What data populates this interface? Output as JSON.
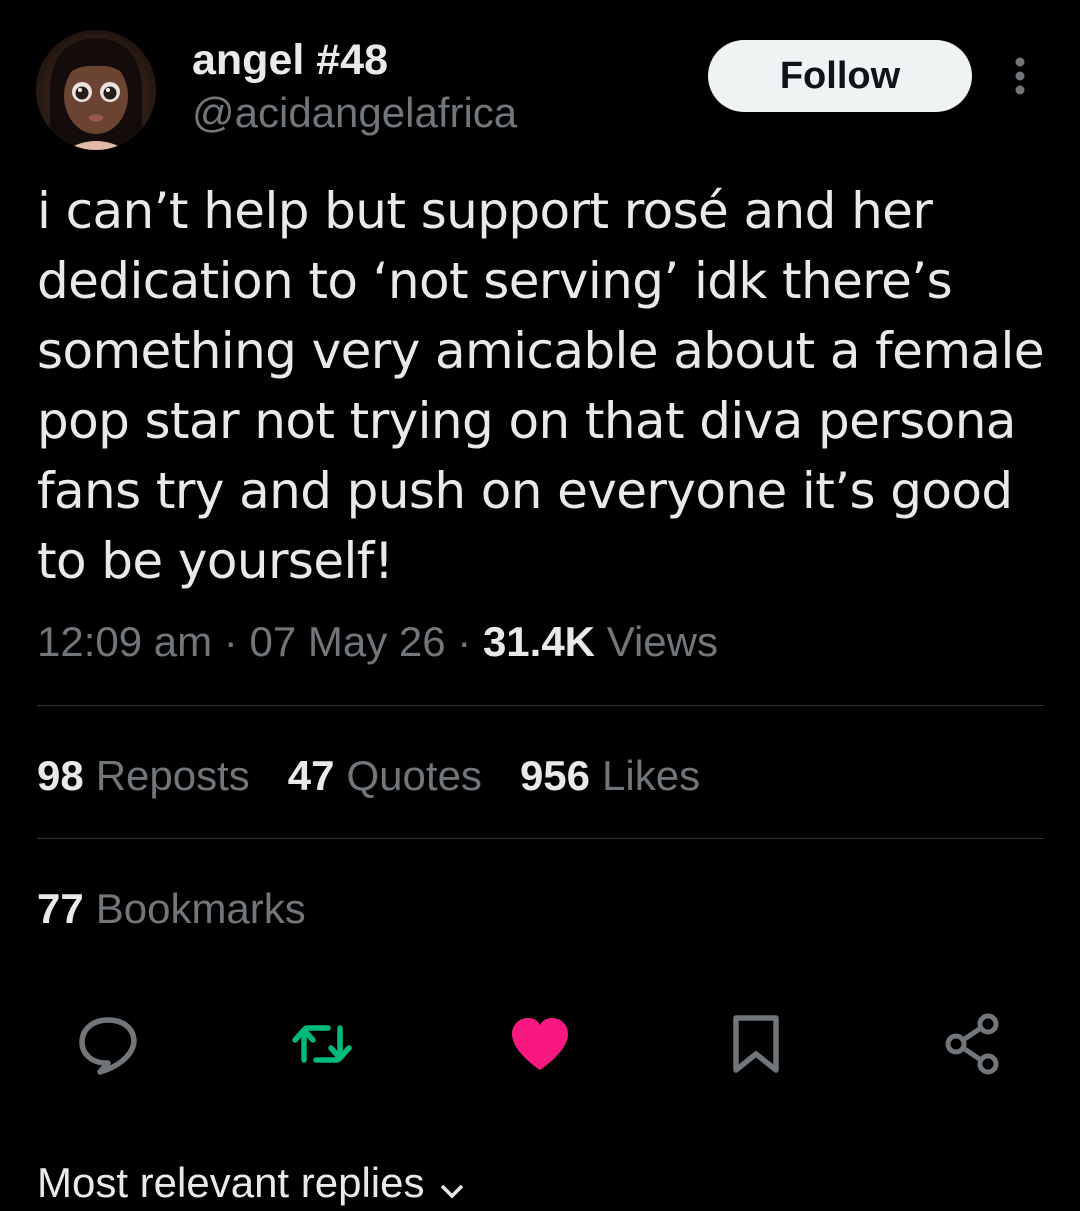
{
  "author": {
    "name": "angel #48",
    "handle": "@acidangelafrica"
  },
  "follow_label": "Follow",
  "body": "i can’t help but support rosé and her\ndedication to ‘not serving’ idk there’s\nsomething very amicable about a female\npop star not trying on that diva persona\nfans try and push on everyone it’s good\nto be yourself!",
  "meta": {
    "time": "12:09 am",
    "separator": "·",
    "date": "07 May 26",
    "views_count": "31.4K",
    "views_label": "Views"
  },
  "stats": {
    "reposts_count": "98",
    "reposts_label": "Reposts",
    "quotes_count": "47",
    "quotes_label": "Quotes",
    "likes_count": "956",
    "likes_label": "Likes",
    "bookmarks_count": "77",
    "bookmarks_label": "Bookmarks"
  },
  "actions": {
    "reply_icon": "reply-icon",
    "repost_icon": "repost-icon",
    "like_icon": "heart-icon",
    "bookmark_icon": "bookmark-icon",
    "share_icon": "share-icon"
  },
  "replies_sort_label": "Most relevant replies",
  "colors": {
    "background": "#000000",
    "text_primary": "#e7e9ea",
    "text_secondary": "#71767b",
    "divider": "#2f3336",
    "repost_active": "#00ba7c",
    "like_active": "#f91880",
    "follow_bg": "#eff3f4"
  }
}
